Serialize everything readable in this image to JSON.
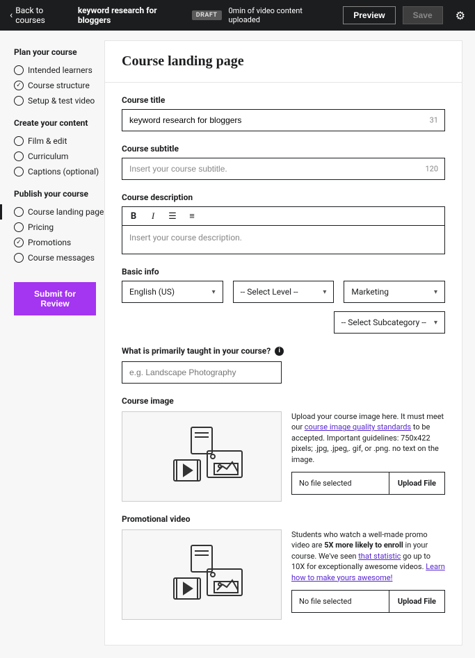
{
  "topbar": {
    "back": "Back to courses",
    "title": "keyword research for bloggers",
    "draft": "DRAFT",
    "status": "0min of video content uploaded",
    "preview": "Preview",
    "save": "Save"
  },
  "sidebar": {
    "section1": "Plan your course",
    "items1": {
      "a": "Intended learners",
      "b": "Course structure",
      "c": "Setup & test video"
    },
    "section2": "Create your content",
    "items2": {
      "a": "Film & edit",
      "b": "Curriculum",
      "c": "Captions (optional)"
    },
    "section3": "Publish your course",
    "items3": {
      "a": "Course landing page",
      "b": "Pricing",
      "c": "Promotions",
      "d": "Course messages"
    },
    "submit": "Submit for Review"
  },
  "page": {
    "title": "Course landing page",
    "ct_label": "Course title",
    "ct_value": "keyword research for bloggers",
    "ct_count": "31",
    "cs_label": "Course subtitle",
    "cs_placeholder": "Insert your course subtitle.",
    "cs_count": "120",
    "cd_label": "Course description",
    "cd_placeholder": "Insert your course description.",
    "basic_label": "Basic info",
    "lang": "English (US)",
    "level": "-- Select Level --",
    "cat": "Marketing",
    "subcat": "-- Select Subcategory --",
    "taught_label": "What is primarily taught in your course?",
    "taught_placeholder": "e.g. Landscape Photography",
    "img_label": "Course image",
    "img_desc_1": "Upload your course image here. It must meet our ",
    "img_link": "course image quality standards",
    "img_desc_2": " to be accepted. Important guidelines: 750x422 pixels; .jpg, .jpeg,. gif, or .png. no text on the image.",
    "nofile": "No file selected",
    "upload": "Upload File",
    "vid_label": "Promotional video",
    "vid_desc_1": "Students who watch a well-made promo video are ",
    "vid_bold": "5X more likely to enroll",
    "vid_desc_2": " in your course. We've seen ",
    "vid_link1": "that statistic",
    "vid_desc_3": " go up to 10X for exceptionally awesome videos. ",
    "vid_link2": "Learn how to make yours awesome!"
  }
}
